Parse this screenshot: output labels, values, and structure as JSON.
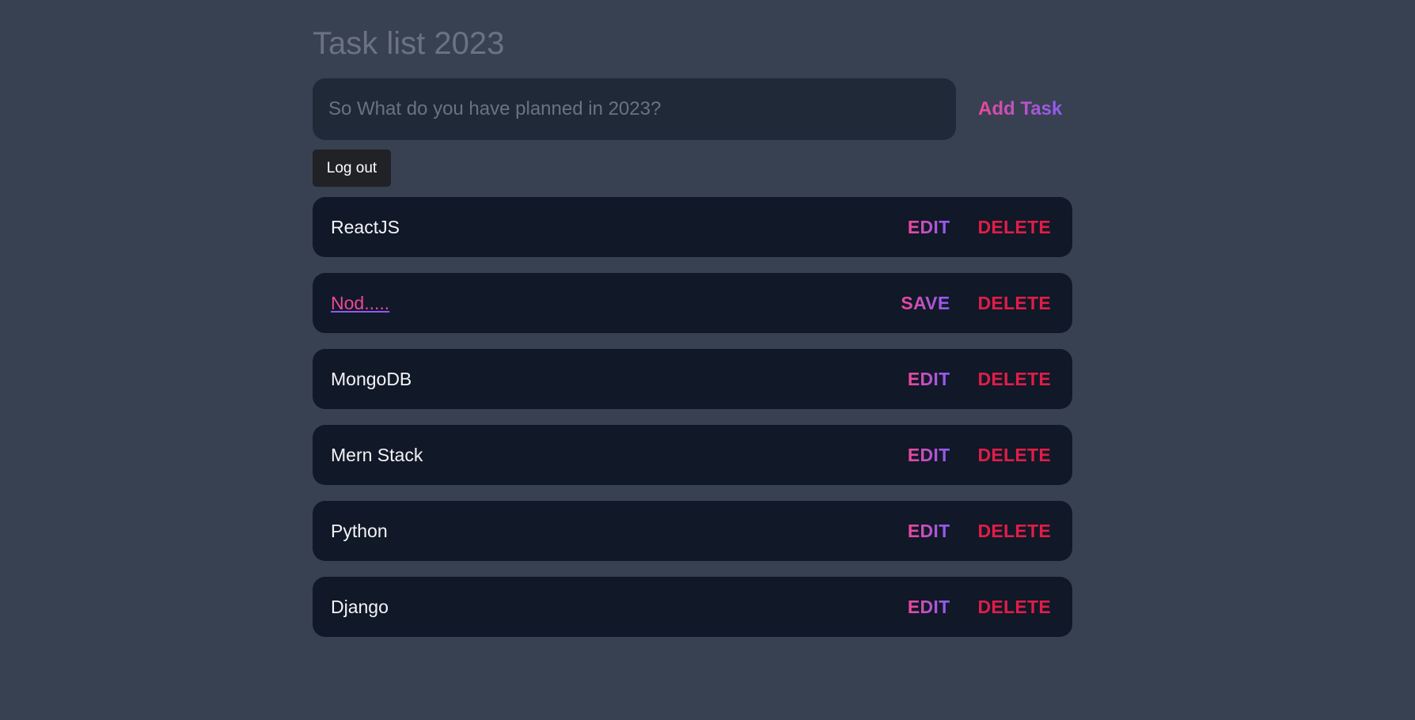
{
  "app": {
    "title": "Task list 2023"
  },
  "new_task": {
    "placeholder": "So What do you have planned in 2023?",
    "value": "",
    "add_label": "Add Task"
  },
  "logout_label": "Log out",
  "tasks": [
    {
      "text": "ReactJS",
      "editing": false,
      "primary_label": "EDIT",
      "delete_label": "DELETE"
    },
    {
      "text": "Nod.....",
      "editing": true,
      "primary_label": "SAVE",
      "delete_label": "DELETE"
    },
    {
      "text": "MongoDB",
      "editing": false,
      "primary_label": "EDIT",
      "delete_label": "DELETE"
    },
    {
      "text": "Mern Stack",
      "editing": false,
      "primary_label": "EDIT",
      "delete_label": "DELETE"
    },
    {
      "text": "Python",
      "editing": false,
      "primary_label": "EDIT",
      "delete_label": "DELETE"
    },
    {
      "text": "Django",
      "editing": false,
      "primary_label": "EDIT",
      "delete_label": "DELETE"
    }
  ],
  "colors": {
    "background": "#374151",
    "input_bg": "#1f2937",
    "row_bg": "#111827",
    "gradient_start": "#ec4899",
    "gradient_end": "#8b5cf6",
    "delete": "#e11d48"
  }
}
